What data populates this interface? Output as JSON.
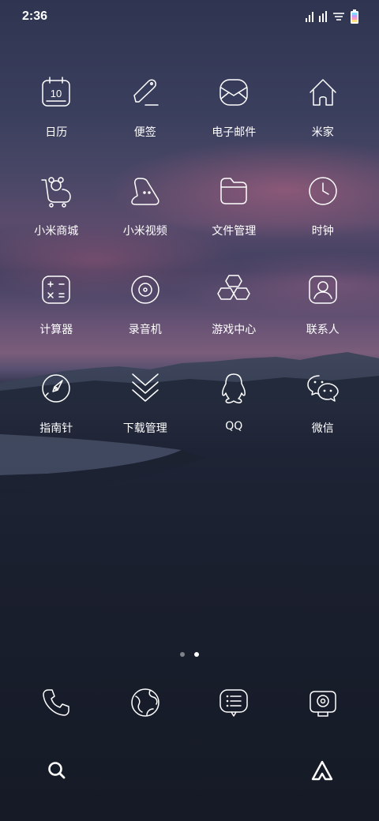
{
  "status_bar": {
    "time": "2:36",
    "icons": [
      "signal-icon",
      "signal-icon",
      "wifi-icon",
      "battery-icon"
    ]
  },
  "apps": [
    {
      "label": "日历",
      "icon": "calendar-icon",
      "calendar_day": "10"
    },
    {
      "label": "便签",
      "icon": "notes-icon"
    },
    {
      "label": "电子邮件",
      "icon": "email-icon"
    },
    {
      "label": "米家",
      "icon": "home-icon"
    },
    {
      "label": "小米商城",
      "icon": "mi-store-icon"
    },
    {
      "label": "小米视频",
      "icon": "video-icon"
    },
    {
      "label": "文件管理",
      "icon": "folder-icon"
    },
    {
      "label": "时钟",
      "icon": "clock-icon"
    },
    {
      "label": "计算器",
      "icon": "calculator-icon"
    },
    {
      "label": "录音机",
      "icon": "recorder-icon"
    },
    {
      "label": "游戏中心",
      "icon": "game-center-icon"
    },
    {
      "label": "联系人",
      "icon": "contacts-icon"
    },
    {
      "label": "指南针",
      "icon": "compass-icon"
    },
    {
      "label": "下载管理",
      "icon": "downloads-icon"
    },
    {
      "label": "QQ",
      "icon": "qq-icon"
    },
    {
      "label": "微信",
      "icon": "wechat-icon"
    }
  ],
  "page_indicator": {
    "count": 2,
    "active": 2
  },
  "dock": [
    {
      "icon": "phone-icon"
    },
    {
      "icon": "browser-icon"
    },
    {
      "icon": "messages-icon"
    },
    {
      "icon": "camera-icon"
    }
  ],
  "bottom": {
    "left_icon": "search-icon",
    "right_icon": "assistant-icon"
  }
}
